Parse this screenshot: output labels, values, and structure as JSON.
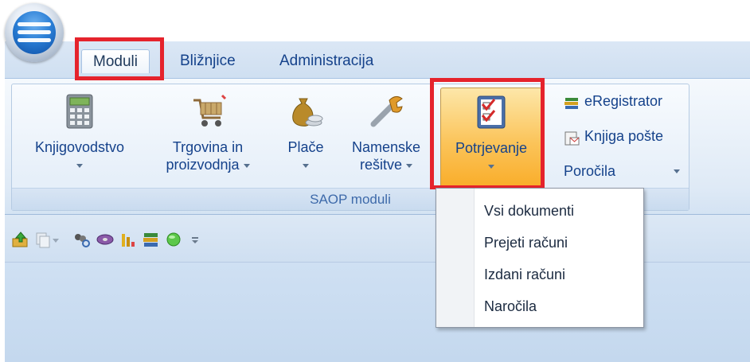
{
  "tabs": [
    {
      "label": "Moduli",
      "active": true
    },
    {
      "label": "Bližnjice",
      "active": false
    },
    {
      "label": "Administracija",
      "active": false
    }
  ],
  "ribbon": {
    "group_caption": "SAOP moduli",
    "buttons": [
      {
        "line1": "Knjigovodstvo",
        "line2": "",
        "icon": "calculator-icon"
      },
      {
        "line1": "Trgovina in",
        "line2": "proizvodnja",
        "icon": "shopping-cart-icon"
      },
      {
        "line1": "Plače",
        "line2": "",
        "icon": "money-bag-icon"
      },
      {
        "line1": "Namenske",
        "line2": "rešitve",
        "icon": "wrench-icon"
      },
      {
        "line1": "Potrjevanje",
        "line2": "",
        "icon": "checklist-icon",
        "pressed": true
      }
    ],
    "small_buttons": [
      {
        "label": "eRegistrator",
        "icon": "books-icon"
      },
      {
        "label": "Knjiga pošte",
        "icon": "mailbook-icon"
      },
      {
        "label": "Poročila",
        "icon": ""
      }
    ]
  },
  "quick_access": [
    "upload-icon",
    "copy-icon",
    "search-people-icon",
    "disc-icon",
    "bar-chart-icon",
    "books-icon",
    "green-orb-icon",
    "customize-arrow-icon"
  ],
  "dropdown_menu": {
    "items": [
      "Vsi dokumenti",
      "Prejeti računi",
      "Izdani računi",
      "Naročila"
    ]
  },
  "colors": {
    "highlight": "#e5232c",
    "ribbon_text": "#15428b",
    "pressed_button": "#fbc45a"
  }
}
